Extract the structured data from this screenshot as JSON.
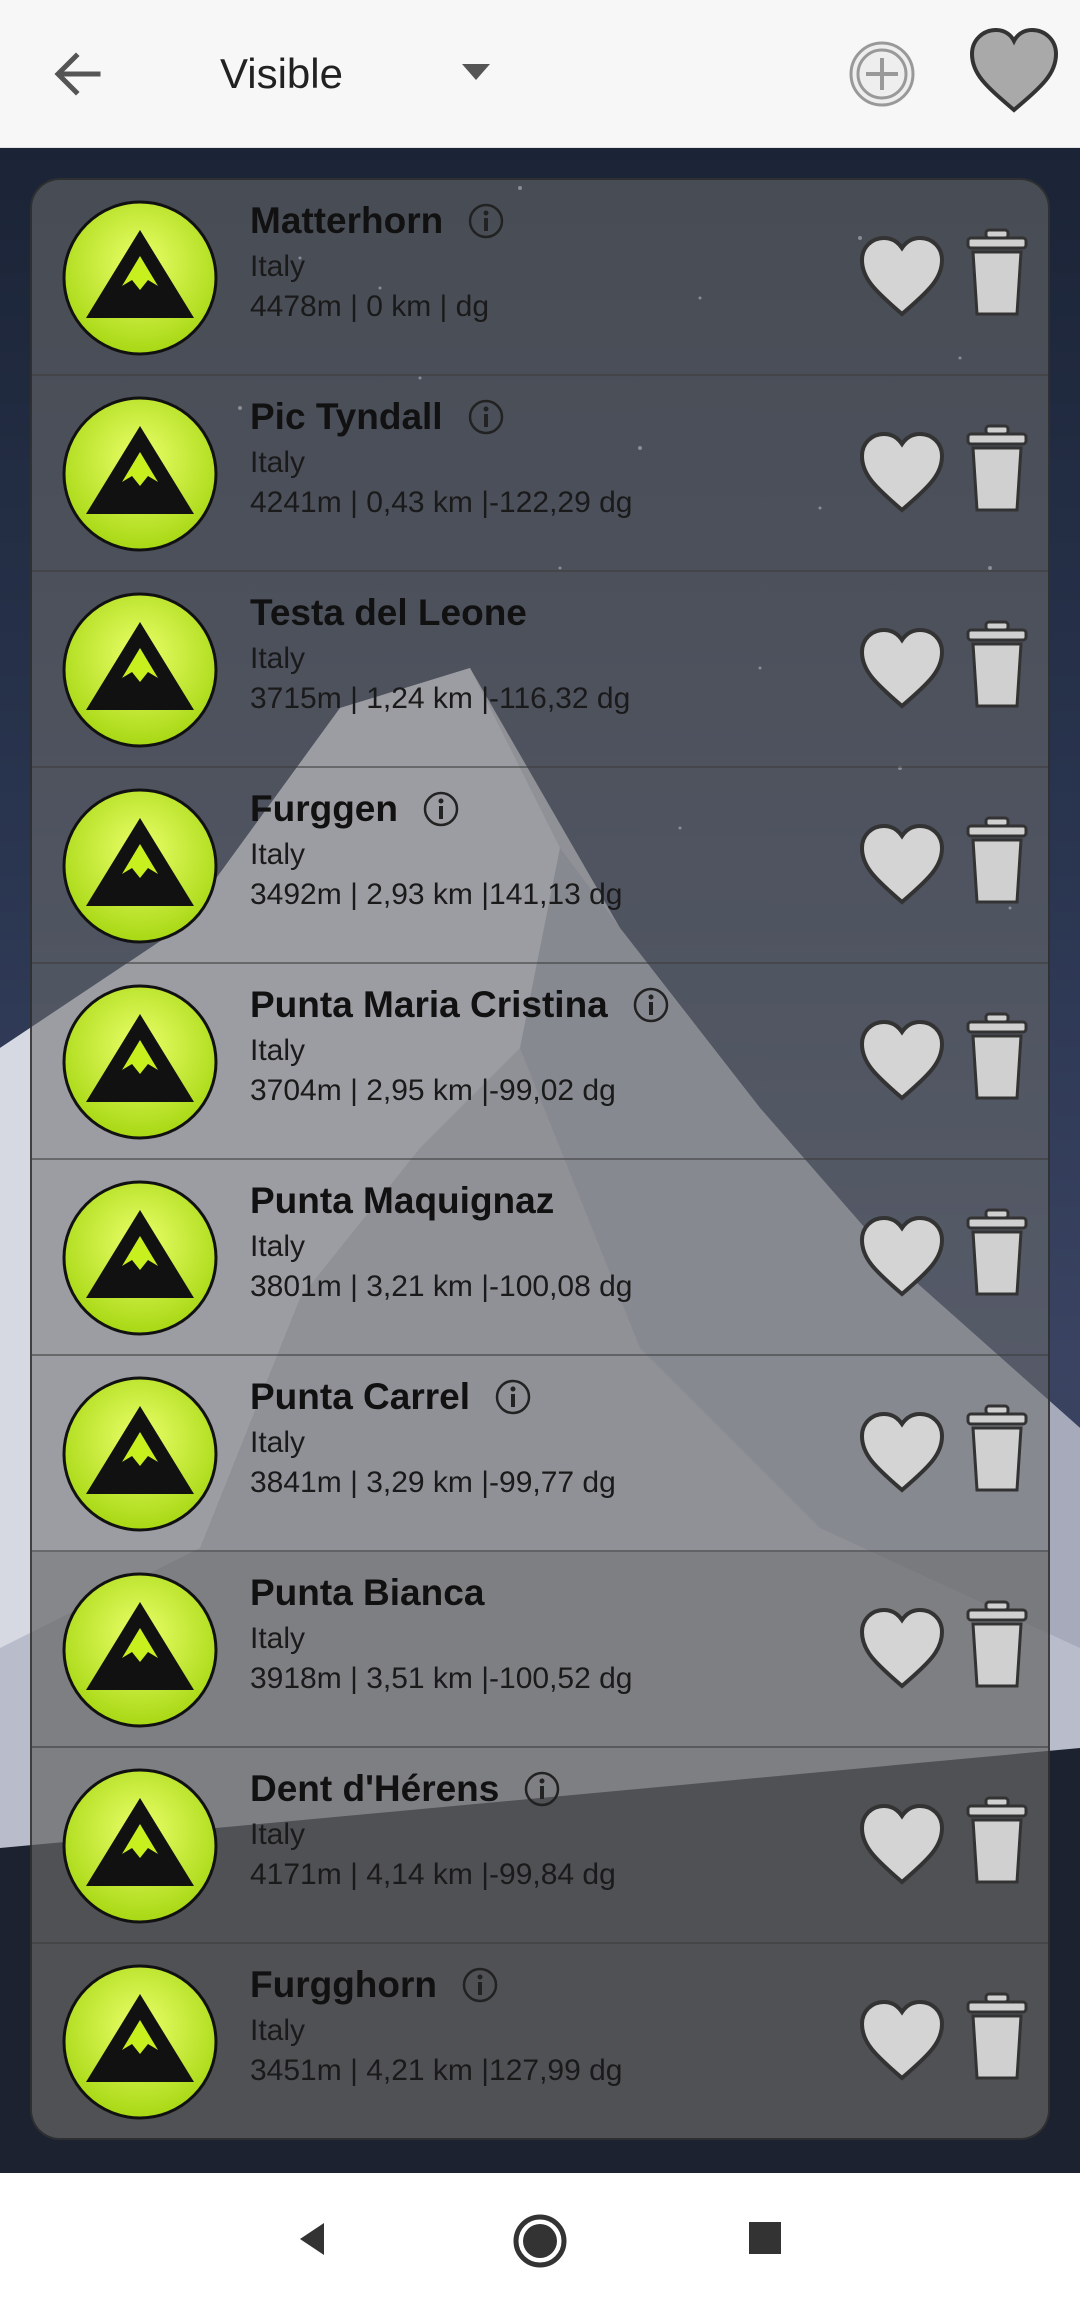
{
  "header": {
    "filter_value": "Visible",
    "back_icon": "arrow-left-icon",
    "add_icon": "plus-circle-icon",
    "favorites_icon": "heart-icon"
  },
  "colors": {
    "topbar": "#f7f7f7",
    "peak_icon_fill": "#c8f01e",
    "heart_fill": "#d4d4d4",
    "trash_fill": "#d0d0d0"
  },
  "peaks": [
    {
      "name": "Matterhorn",
      "country": "Italy",
      "details": "4478m | 0 km | dg",
      "has_info": true
    },
    {
      "name": "Pic Tyndall",
      "country": "Italy",
      "details": "4241m | 0,43 km |-122,29 dg",
      "has_info": true
    },
    {
      "name": "Testa del Leone",
      "country": "Italy",
      "details": "3715m | 1,24 km |-116,32 dg",
      "has_info": false
    },
    {
      "name": "Furggen",
      "country": "Italy",
      "details": "3492m | 2,93 km |141,13 dg",
      "has_info": true
    },
    {
      "name": "Punta Maria Cristina",
      "country": "Italy",
      "details": "3704m | 2,95 km |-99,02 dg",
      "has_info": true
    },
    {
      "name": "Punta Maquignaz",
      "country": "Italy",
      "details": "3801m | 3,21 km |-100,08 dg",
      "has_info": false
    },
    {
      "name": "Punta Carrel",
      "country": "Italy",
      "details": "3841m | 3,29 km |-99,77 dg",
      "has_info": true
    },
    {
      "name": "Punta Bianca",
      "country": "Italy",
      "details": "3918m | 3,51 km |-100,52 dg",
      "has_info": false
    },
    {
      "name": "Dent d'Hérens",
      "country": "Italy",
      "details": "4171m | 4,14 km |-99,84 dg",
      "has_info": true
    },
    {
      "name": "Furgghorn",
      "country": "Italy",
      "details": "3451m | 4,21 km |127,99 dg",
      "has_info": true
    }
  ],
  "navbar": {
    "back_icon": "triangle-back-icon",
    "home_icon": "circle-home-icon",
    "recents_icon": "square-recents-icon"
  }
}
